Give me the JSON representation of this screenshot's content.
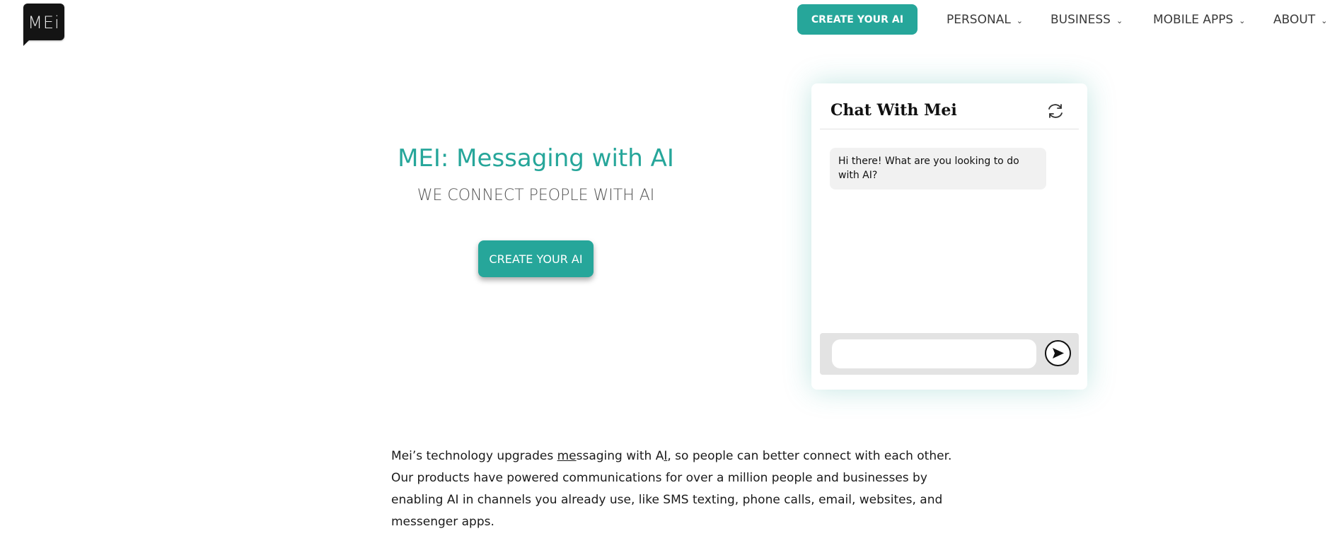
{
  "header": {
    "logo_text": "MEi",
    "cta_label": "CREATE YOUR AI",
    "nav": [
      {
        "label": "PERSONAL"
      },
      {
        "label": "BUSINESS"
      },
      {
        "label": "MOBILE APPS"
      },
      {
        "label": "ABOUT"
      }
    ]
  },
  "hero": {
    "title": "MEI: Messaging with AI",
    "subtitle": "WE CONNECT PEOPLE WITH AI",
    "cta_label": "CREATE YOUR AI"
  },
  "chat": {
    "title": "Chat With Mei",
    "refresh_icon": "refresh-icon",
    "messages": [
      {
        "from": "bot",
        "text": "Hi there! What are you looking to do with AI?"
      }
    ],
    "input_value": "",
    "input_placeholder": "",
    "send_icon": "send-icon"
  },
  "body": {
    "part1": "Mei’s technology upgrades ",
    "underlined1": "me",
    "part2": "ssaging with A",
    "underlined2": "I",
    "part3": ", so people can better connect with each other. Our products have powered communications for over a million people and businesses by enabling AI in channels you already use, like SMS texting, phone calls, email, websites, and messenger apps."
  },
  "colors": {
    "accent": "#26a69a",
    "logo_bg": "#141414",
    "input_bar": "#e3e3e3",
    "bubble_bg": "#f1f1f1"
  }
}
